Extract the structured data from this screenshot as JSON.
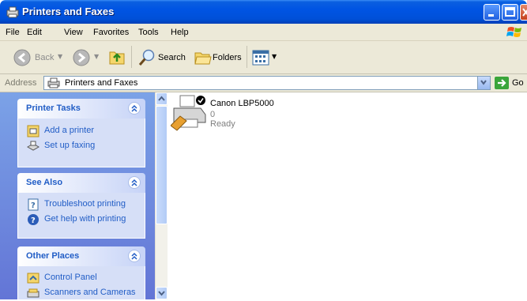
{
  "window": {
    "title": "Printers and Faxes"
  },
  "menu": [
    "File",
    "Edit",
    "View",
    "Favorites",
    "Tools",
    "Help"
  ],
  "toolbar": {
    "back": "Back",
    "search": "Search",
    "folders": "Folders"
  },
  "address": {
    "label": "Address",
    "value": "Printers and Faxes",
    "go": "Go"
  },
  "panels": {
    "printer_tasks": {
      "title": "Printer Tasks",
      "items": [
        "Add a printer",
        "Set up faxing"
      ]
    },
    "see_also": {
      "title": "See Also",
      "items": [
        "Troubleshoot printing",
        "Get help with printing"
      ]
    },
    "other_places": {
      "title": "Other Places",
      "items": [
        "Control Panel",
        "Scanners and Cameras"
      ]
    }
  },
  "printer": {
    "name": "Canon LBP5000",
    "jobs": "0",
    "status": "Ready"
  },
  "colors": {
    "title_bar": "#0054e3",
    "task_pane": "#6f8fdf",
    "link": "#215dc6"
  }
}
